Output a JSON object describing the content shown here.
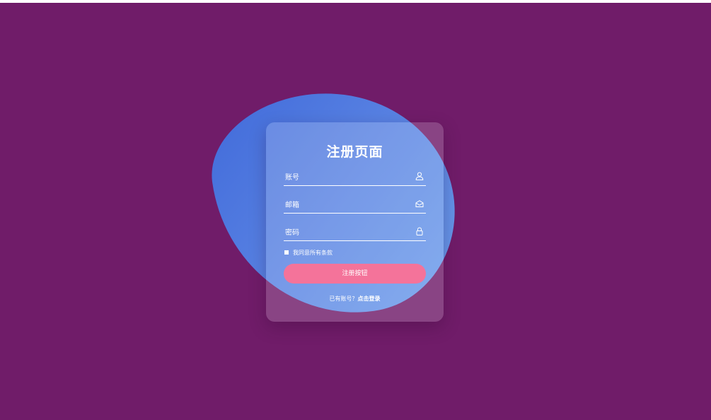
{
  "page": {
    "background_color": "#701c69",
    "title": "注册页面"
  },
  "form": {
    "username_placeholder": "账号",
    "email_placeholder": "邮箱",
    "password_placeholder": "密码",
    "agree_label": "我同意所有条款",
    "submit_label": "注册按钮",
    "login_prompt": "已有账号？",
    "login_link": "点击登录"
  },
  "icons": {
    "username": "user-icon",
    "email": "envelope-icon",
    "password": "lock-icon"
  },
  "colors": {
    "accent_button": "#f4739a",
    "blob_start": "#3f6fe0",
    "blob_end": "#6aa3f2"
  }
}
